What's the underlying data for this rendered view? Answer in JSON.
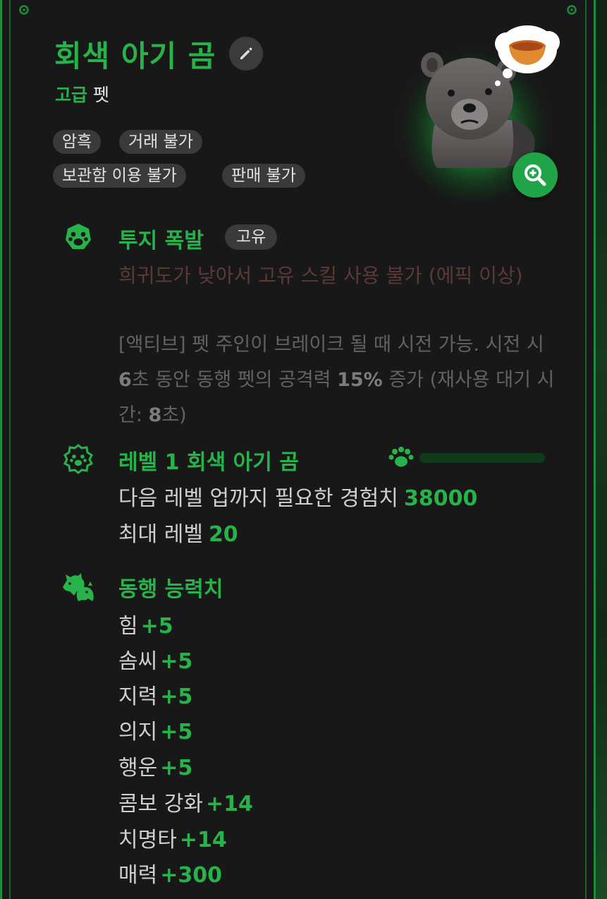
{
  "header": {
    "title": "회색 아기 곰",
    "grade": "고급",
    "kind": "펫"
  },
  "tags": [
    "암흑",
    "거래 불가",
    "보관함 이용 불가",
    "판매 불가"
  ],
  "skill": {
    "title": "투지 폭발",
    "badge": "고유",
    "warning": "희귀도가 낮아서 고유 스킬 사용 불가 (에픽 이상)",
    "desc_a": "[액티브] 펫 주인이 브레이크 될 때 시전 가능. 시전 시 ",
    "desc_duration": "6",
    "desc_b": "초 동안 동행 펫의 공격력 ",
    "desc_attack": "15%",
    "desc_c": " 증가 (재사용 대기 시간: ",
    "desc_cooldown": "8",
    "desc_d": "초)"
  },
  "level": {
    "title": "레벨 1 회색 아기 곰",
    "next_label": "다음 레벨 업까지 필요한 경험치",
    "next_value": "38000",
    "max_label": "최대 레벨",
    "max_value": "20",
    "progress": 0
  },
  "stats": {
    "title": "동행 능력치",
    "items": [
      {
        "label": "힘",
        "value": "+5"
      },
      {
        "label": "솜씨",
        "value": "+5"
      },
      {
        "label": "지력",
        "value": "+5"
      },
      {
        "label": "의지",
        "value": "+5"
      },
      {
        "label": "행운",
        "value": "+5"
      },
      {
        "label": "콤보 강화",
        "value": "+14"
      },
      {
        "label": "치명타",
        "value": "+14"
      },
      {
        "label": "매력",
        "value": "+300"
      }
    ]
  },
  "colors": {
    "accent": "#27b24a",
    "card_bg": "#181818",
    "tag_bg": "#3a3a3a",
    "warning": "#5a3a36",
    "border": "#1e8c3c"
  },
  "icons": {
    "edit": "pencil-icon",
    "zoom": "zoom-in-icon",
    "skill": "paw-icon",
    "level": "paw-badge-icon",
    "stats": "animal-heads-icon",
    "progress": "paw-icon"
  }
}
